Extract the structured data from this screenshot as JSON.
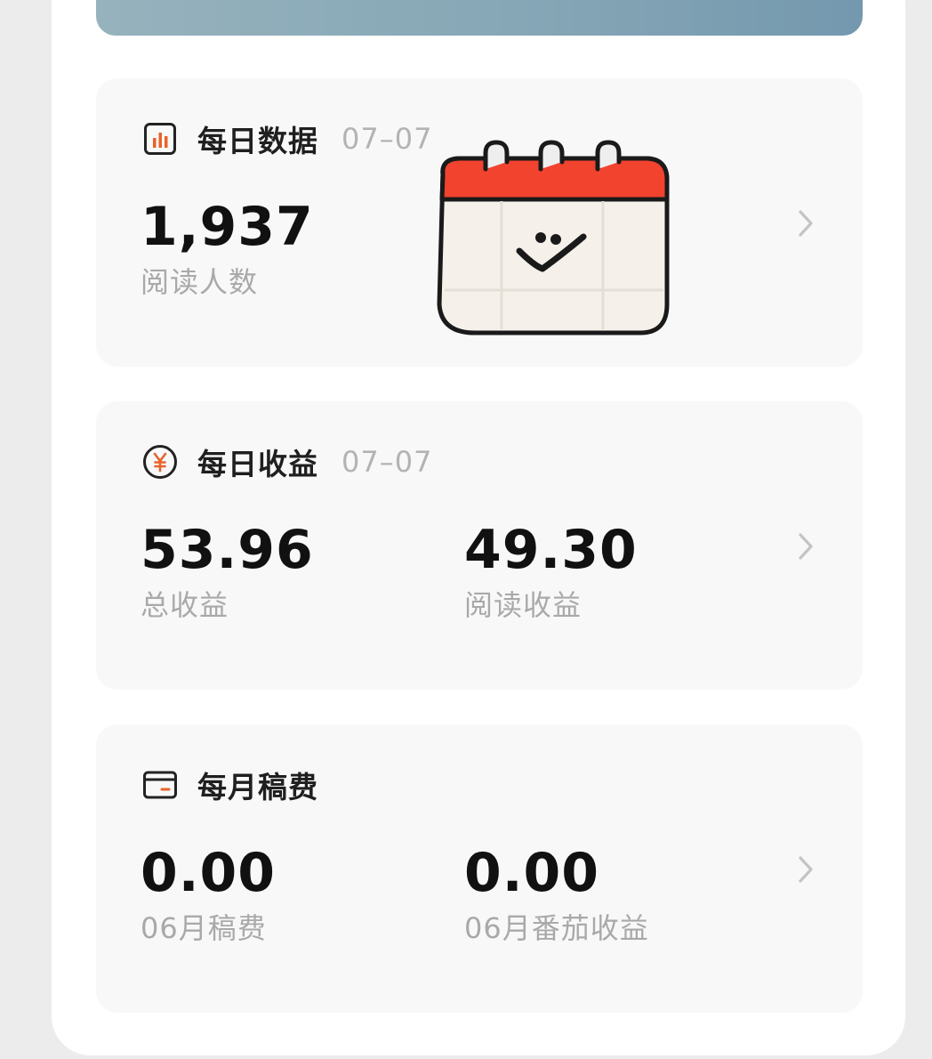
{
  "daily_data": {
    "icon": "bar-chart-icon",
    "title": "每日数据",
    "date": "07–07",
    "metrics": [
      {
        "value": "1,937",
        "label": "阅读人数"
      }
    ]
  },
  "daily_income": {
    "icon": "yuan-coin-icon",
    "title": "每日收益",
    "date": "07–07",
    "metrics": [
      {
        "value": "53.96",
        "label": "总收益"
      },
      {
        "value": "49.30",
        "label": "阅读收益"
      }
    ]
  },
  "monthly_fee": {
    "icon": "wallet-card-icon",
    "title": "每月稿费",
    "metrics": [
      {
        "value": "0.00",
        "label": "06月稿费"
      },
      {
        "value": "0.00",
        "label": "06月番茄收益"
      }
    ]
  },
  "sticker": {
    "icon": "calendar-smile-sticker-icon"
  },
  "colors": {
    "accent": "#e8632b",
    "calendar_red": "#f2432f",
    "banner_start": "#96b2bd",
    "banner_end": "#7498ae"
  }
}
